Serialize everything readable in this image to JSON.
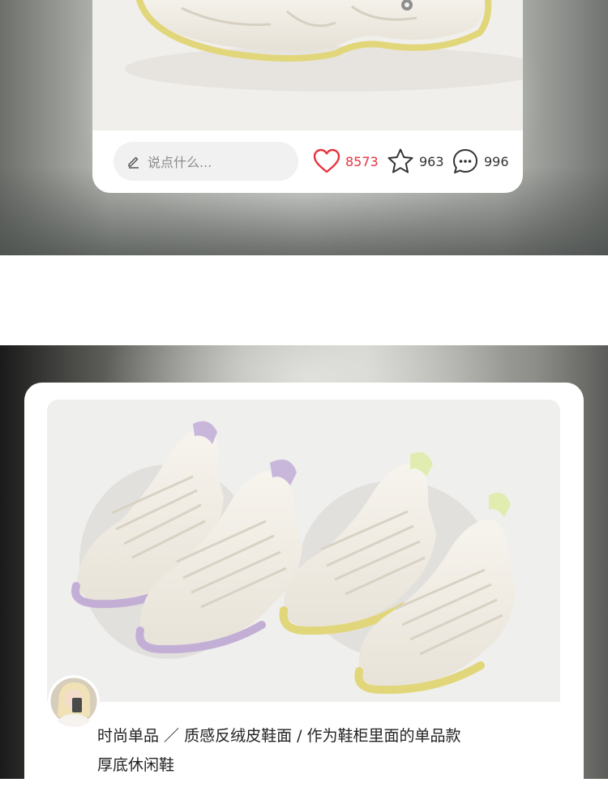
{
  "post_top": {
    "comment_placeholder": "说点什么...",
    "like_count": "8573",
    "star_count": "963",
    "comment_count": "996",
    "accent_color": "#e8333e",
    "icons": [
      "edit-pen-icon",
      "heart-icon",
      "star-icon",
      "chat-bubble-icon"
    ]
  },
  "post_bottom": {
    "caption_line1": "时尚单品 ／ 质感反绒皮鞋面 / 作为鞋柜里面的单品款",
    "caption_line2": "厚底休闲鞋"
  }
}
